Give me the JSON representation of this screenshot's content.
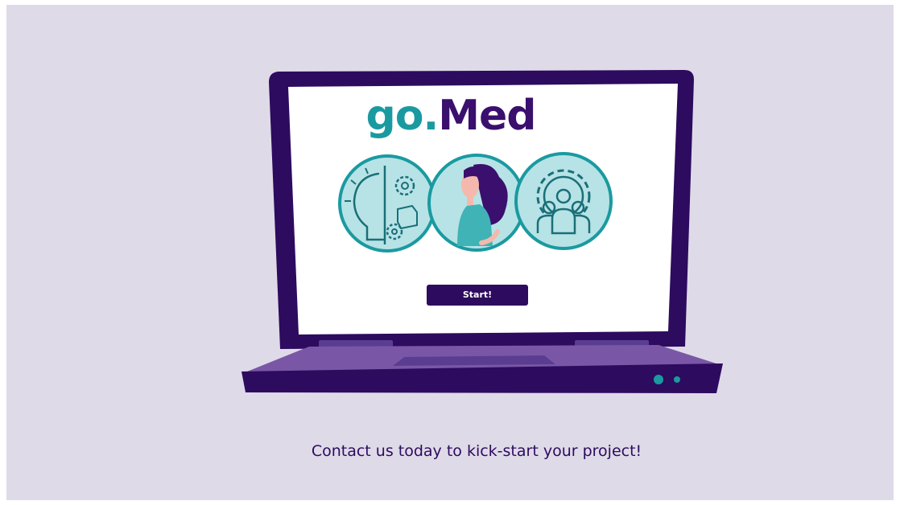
{
  "logo": {
    "part1": "go.",
    "part2": "Med"
  },
  "start_button": {
    "label": "Start!"
  },
  "footer": {
    "contact_text": "Contact us today to kick-start your project!"
  },
  "icons": {
    "idea_gears": "lightbulb-gears-icon",
    "woman": "woman-illustration-icon",
    "team_gear": "team-gear-icon"
  },
  "colors": {
    "background": "#dfdae8",
    "laptop_dark": "#2d0b5e",
    "laptop_base": "#7a57a6",
    "teal": "#1a9aa0",
    "teal_light": "#b7e3e6",
    "brand_purple": "#3a0f6e"
  }
}
